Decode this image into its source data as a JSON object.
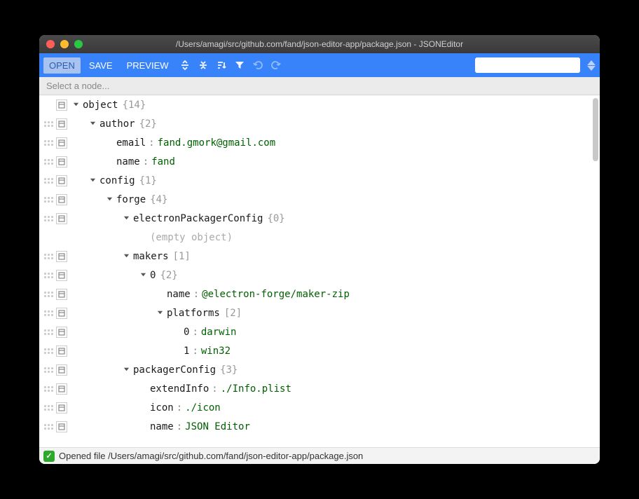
{
  "window": {
    "title": "/Users/amagi/src/github.com/fand/json-editor-app/package.json - JSONEditor"
  },
  "toolbar": {
    "open": "OPEN",
    "save": "SAVE",
    "preview": "PREVIEW"
  },
  "breadcrumb": {
    "text": "Select a node..."
  },
  "tree": [
    {
      "depth": 0,
      "drag": false,
      "menu": true,
      "caret": "down",
      "key": "object",
      "count": "{14}"
    },
    {
      "depth": 1,
      "drag": true,
      "menu": true,
      "caret": "down",
      "key": "author",
      "count": "{2}"
    },
    {
      "depth": 2,
      "drag": true,
      "menu": true,
      "caret": "none",
      "key": "email",
      "sep": ":",
      "val": "fand.gmork@gmail.com"
    },
    {
      "depth": 2,
      "drag": true,
      "menu": true,
      "caret": "none",
      "key": "name",
      "sep": ":",
      "val": "fand"
    },
    {
      "depth": 1,
      "drag": true,
      "menu": true,
      "caret": "down",
      "key": "config",
      "count": "{1}"
    },
    {
      "depth": 2,
      "drag": true,
      "menu": true,
      "caret": "down",
      "key": "forge",
      "count": "{4}"
    },
    {
      "depth": 3,
      "drag": true,
      "menu": true,
      "caret": "down",
      "key": "electronPackagerConfig",
      "count": "{0}"
    },
    {
      "depth": 4,
      "drag": false,
      "menu": false,
      "caret": "none",
      "empty": "(empty object)"
    },
    {
      "depth": 3,
      "drag": true,
      "menu": true,
      "caret": "down",
      "key": "makers",
      "count": "[1]"
    },
    {
      "depth": 4,
      "drag": true,
      "menu": true,
      "caret": "down",
      "idx": "0",
      "count": "{2}"
    },
    {
      "depth": 5,
      "drag": true,
      "menu": true,
      "caret": "none",
      "key": "name",
      "sep": ":",
      "val": "@electron-forge/maker-zip"
    },
    {
      "depth": 5,
      "drag": true,
      "menu": true,
      "caret": "down",
      "key": "platforms",
      "count": "[2]"
    },
    {
      "depth": 6,
      "drag": true,
      "menu": true,
      "caret": "none",
      "idx": "0",
      "sep": ":",
      "val": "darwin"
    },
    {
      "depth": 6,
      "drag": true,
      "menu": true,
      "caret": "none",
      "idx": "1",
      "sep": ":",
      "val": "win32"
    },
    {
      "depth": 3,
      "drag": true,
      "menu": true,
      "caret": "down",
      "key": "packagerConfig",
      "count": "{3}"
    },
    {
      "depth": 4,
      "drag": true,
      "menu": true,
      "caret": "none",
      "key": "extendInfo",
      "sep": ":",
      "val": "./Info.plist"
    },
    {
      "depth": 4,
      "drag": true,
      "menu": true,
      "caret": "none",
      "key": "icon",
      "sep": ":",
      "val": "./icon"
    },
    {
      "depth": 4,
      "drag": true,
      "menu": true,
      "caret": "none",
      "key": "name",
      "sep": ":",
      "val": "JSON Editor"
    }
  ],
  "status": {
    "text": "Opened file /Users/amagi/src/github.com/fand/json-editor-app/package.json"
  }
}
